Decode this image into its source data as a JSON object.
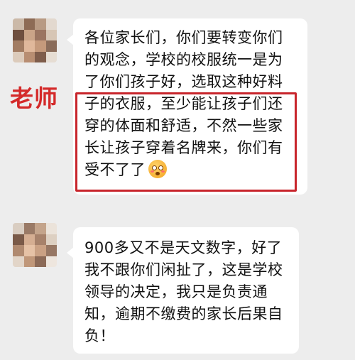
{
  "chat": {
    "label": "老师",
    "messages": [
      {
        "lines": [
          "各位家长们，你们要转变你们",
          "的观念，学校的校服统一是为",
          "了你们孩子好，选取这种好料",
          "子的衣服，至少能让孩子们还",
          "穿的体面和舒适，不然一些家",
          "长让孩子穿着名牌来，你们有",
          "受不了了"
        ],
        "trailing_emoji": "flushed-face-emoji"
      },
      {
        "lines": [
          "900多又不是天文数字，好了",
          "我不跟你们闲扯了，这是学校",
          "领导的决定，我只是负责通",
          "知，逾期不缴费的家长后果自",
          "负！"
        ]
      }
    ]
  },
  "colors": {
    "background": "#ededed",
    "bubble": "#ffffff",
    "highlight": "#c8252c",
    "label": "#d42a2a"
  }
}
